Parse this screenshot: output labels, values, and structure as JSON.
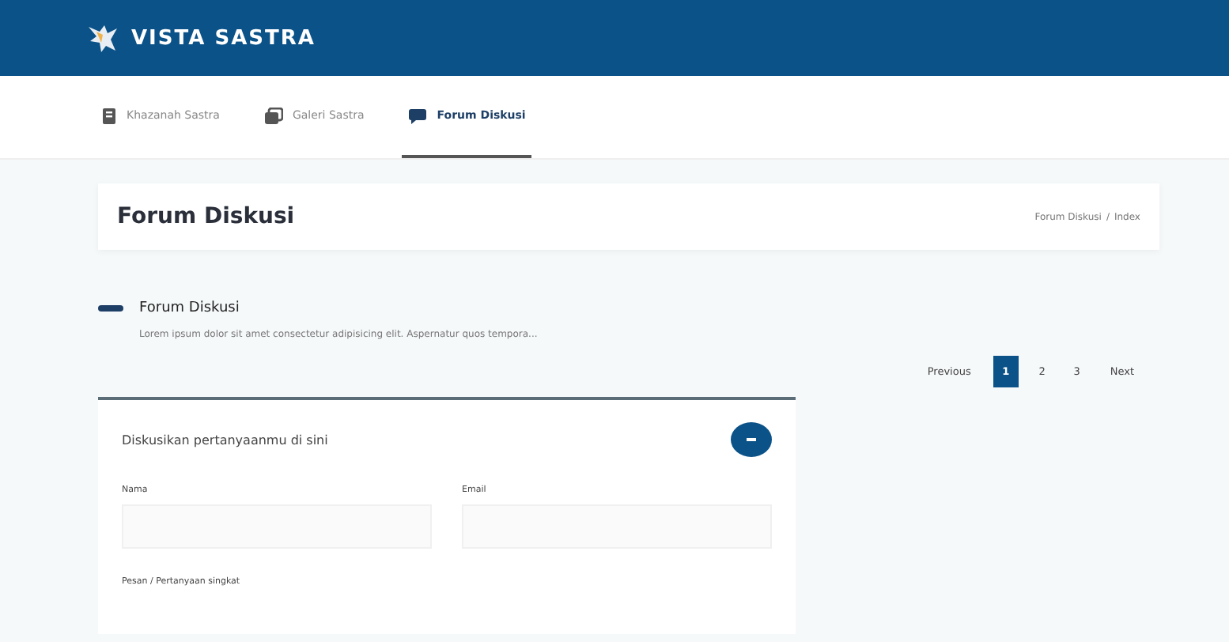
{
  "header": {
    "brand": "VISTA SASTRA"
  },
  "nav": [
    {
      "label": "Khazanah Sastra",
      "selected": false
    },
    {
      "label": "Galeri Sastra",
      "selected": false
    },
    {
      "label": "Forum Diskusi",
      "selected": true
    }
  ],
  "page_title": "Forum Diskusi",
  "breadcrumb": [
    "Forum Diskusi",
    "/",
    "Index"
  ],
  "section": {
    "title": "Forum Diskusi",
    "description": "Lorem ipsum dolor sit amet consectetur adipisicing elit. Aspernatur quos tempora..."
  },
  "pagination": [
    {
      "label": "Previous",
      "kind": "text",
      "selected": false
    },
    {
      "label": "1",
      "kind": "page",
      "selected": true
    },
    {
      "label": "2",
      "kind": "page",
      "selected": false
    },
    {
      "label": "3",
      "kind": "page",
      "selected": false
    },
    {
      "label": "Next",
      "kind": "text",
      "selected": false
    }
  ],
  "form": {
    "title": "Diskusikan pertanyaanmu di sini",
    "expanded": true,
    "fields": [
      {
        "label": "Nama"
      },
      {
        "label": "Email"
      }
    ],
    "message_label": "Pesan / Pertanyaan singkat"
  }
}
